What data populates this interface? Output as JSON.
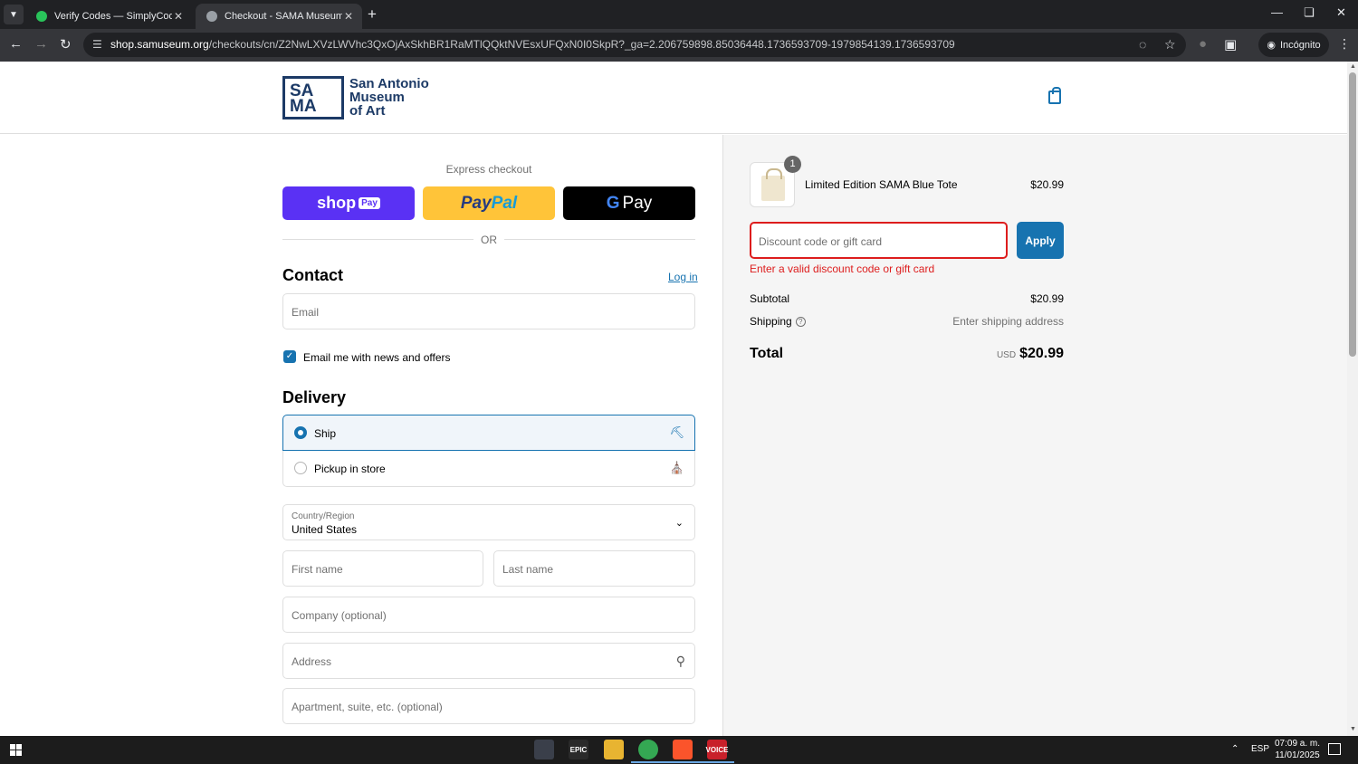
{
  "browser": {
    "tabs": [
      {
        "title": "Verify Codes — SimplyCodes",
        "active": false,
        "favicon_color": "#29c35a"
      },
      {
        "title": "Checkout - SAMA Museum Sho",
        "active": true,
        "favicon_color": "#9aa0a6"
      }
    ],
    "url_host": "shop.samuseum.org",
    "url_path": "/checkouts/cn/Z2NwLXVzLWVhc3QxOjAxSkhBR1RaMTlQQktNVEsxUFQxN0I0SkpR?_ga=2.206759898.85036448.1736593709-1979854139.1736593709",
    "incognito_label": "Incógnito"
  },
  "store": {
    "logo_mark_line1": "SA",
    "logo_mark_line2": "MA",
    "logo_text_line1": "San Antonio",
    "logo_text_line2": "Museum",
    "logo_text_line3": "of Art"
  },
  "checkout": {
    "express_label": "Express checkout",
    "shop_pay_label": "shop",
    "shop_pay_badge": "Pay",
    "paypal_label_1": "Pay",
    "paypal_label_2": "Pal",
    "gpay_g": "G",
    "gpay_label": "Pay",
    "or_label": "OR",
    "contact_title": "Contact",
    "login_link": "Log in",
    "email_placeholder": "Email",
    "newsletter_label": "Email me with news and offers",
    "newsletter_checked": true,
    "delivery_title": "Delivery",
    "delivery_options": [
      {
        "label": "Ship",
        "selected": true,
        "icon": "truck-icon"
      },
      {
        "label": "Pickup in store",
        "selected": false,
        "icon": "store-icon"
      }
    ],
    "country_label": "Country/Region",
    "country_value": "United States",
    "first_name_placeholder": "First name",
    "last_name_placeholder": "Last name",
    "company_placeholder": "Company (optional)",
    "address_placeholder": "Address",
    "apartment_placeholder": "Apartment, suite, etc. (optional)"
  },
  "order_summary": {
    "item": {
      "name": "Limited Edition SAMA Blue Tote",
      "price": "$20.99",
      "quantity": "1"
    },
    "discount_placeholder": "Discount code or gift card",
    "apply_label": "Apply",
    "discount_error": "Enter a valid discount code or gift card",
    "subtotal_label": "Subtotal",
    "subtotal_value": "$20.99",
    "shipping_label": "Shipping",
    "shipping_value": "Enter shipping address",
    "total_label": "Total",
    "total_currency": "USD",
    "total_value": "$20.99"
  },
  "taskbar": {
    "apps": [
      {
        "name": "app-1",
        "color": "#3a3f4a",
        "label": ""
      },
      {
        "name": "epic-games",
        "color": "#2a2a2a",
        "label": "EPIC"
      },
      {
        "name": "file-explorer",
        "color": "#e8b431",
        "label": ""
      },
      {
        "name": "chrome",
        "color": "#34a853",
        "label": ""
      },
      {
        "name": "brave",
        "color": "#fb542b",
        "label": ""
      },
      {
        "name": "voicemeeter",
        "color": "#c8202a",
        "label": "VOICE"
      }
    ],
    "language": "ESP",
    "time": "07:09 a. m.",
    "date": "11/01/2025"
  }
}
